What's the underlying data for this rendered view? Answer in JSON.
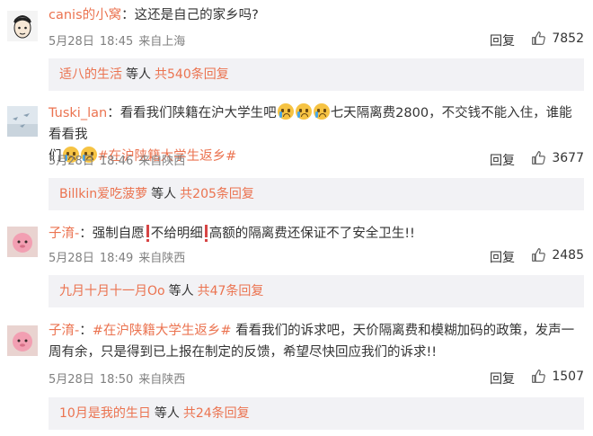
{
  "comments": [
    {
      "username": "canis的小窝",
      "sep": "：",
      "text": "这还是自己的家乡吗?",
      "date": "5月28日",
      "time": "18:45",
      "location": "来自上海",
      "reply_label": "回复",
      "likes": "7852",
      "replies_preview": {
        "who": "适八的生活",
        "mid": "等人",
        "count": "共540条回复"
      }
    },
    {
      "username": "Tuski_lan",
      "sep": "：",
      "text_a": "看看我们陕籍在沪大学生吧",
      "text_b": "七天隔离费2800，不交钱不能入住，谁能看看我",
      "text_c": "们",
      "hashtag": "#在沪陕籍大学生返乡#",
      "date": "5月28日",
      "time": "18:46",
      "location": "来自陕西",
      "reply_label": "回复",
      "likes": "3677",
      "replies_preview": {
        "who": "Billkin爱吃菠萝",
        "mid": "等人",
        "count": "共205条回复"
      }
    },
    {
      "username": "子淯-",
      "sep": "：",
      "text_a": "强制自愿",
      "text_b": "不给明细",
      "text_c": "高额的隔离费还保证不了安全卫生!!",
      "date": "5月28日",
      "time": "18:49",
      "location": "来自陕西",
      "reply_label": "回复",
      "likes": "2485",
      "replies_preview": {
        "who": "九月十月十一月Oo",
        "mid": "等人",
        "count": "共47条回复"
      }
    },
    {
      "username": "子淯-",
      "sep": "：",
      "hashtag": "#在沪陕籍大学生返乡#",
      "text": " 看看我们的诉求吧，天价隔离费和模糊加码的政策，发声一周有余，只是得到已上报在制定的反馈，希望尽快回应我们的诉求!!",
      "date": "5月28日",
      "time": "18:50",
      "location": "来自陕西",
      "reply_label": "回复",
      "likes": "1507",
      "replies_preview": {
        "who": "10月是我的生日",
        "mid": "等人",
        "count": "共24条回复"
      }
    }
  ]
}
